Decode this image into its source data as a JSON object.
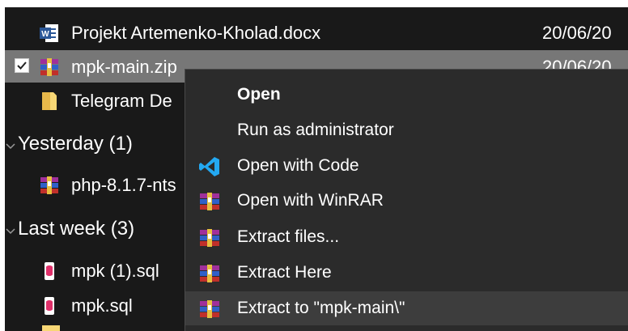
{
  "files_top": [
    {
      "name": "Projekt Artemenko-Kholad.docx",
      "date": "20/06/20",
      "icon": "word-doc-icon"
    },
    {
      "name": "mpk-main.zip",
      "date": "20/06/20",
      "icon": "winrar-archive-icon",
      "selected": true
    },
    {
      "name": "Telegram De",
      "date": "",
      "icon": "folder-icon"
    }
  ],
  "groups": {
    "yesterday": {
      "label": "Yesterday (1)",
      "files": [
        {
          "name": "php-8.1.7-nts",
          "icon": "winrar-archive-icon"
        }
      ]
    },
    "last_week": {
      "label": "Last week (3)",
      "files": [
        {
          "name": "mpk (1).sql",
          "icon": "sql-file-icon"
        },
        {
          "name": "mpk.sql",
          "icon": "sql-file-icon"
        }
      ]
    }
  },
  "context_menu": {
    "items": [
      {
        "label": "Open",
        "bold": true,
        "icon": ""
      },
      {
        "label": "Run as administrator",
        "icon": ""
      },
      {
        "label": "Open with Code",
        "icon": "vscode-icon"
      },
      {
        "label": "Open with WinRAR",
        "icon": "winrar-icon"
      },
      {
        "label": "Extract files...",
        "icon": "winrar-icon"
      },
      {
        "label": "Extract Here",
        "icon": "winrar-icon"
      },
      {
        "label": "Extract to \"mpk-main\\\"",
        "icon": "winrar-icon",
        "hovered": true
      }
    ]
  },
  "colors": {
    "explorer_bg": "#191919",
    "menu_bg": "#2b2b2b",
    "selected_row": "#777777",
    "hover_item": "#3d3d3d",
    "word_blue": "#2b5797",
    "vscode_blue": "#23a9f2",
    "folder_yellow": "#f8d775"
  }
}
